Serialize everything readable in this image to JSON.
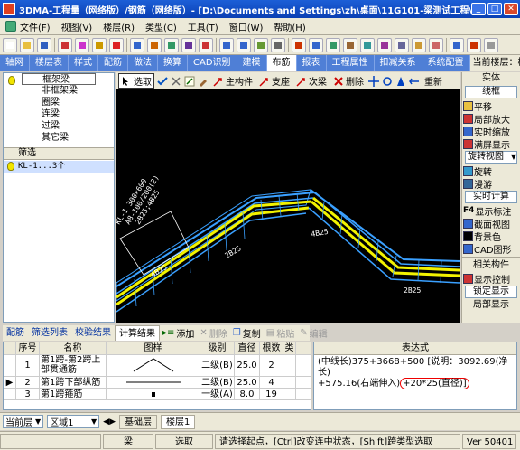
{
  "window": {
    "title": "3DMA-工程量（网络版）/钢筋（网络版）- [D:\\Documents and Settings\\zh\\桌面\\11G101-梁测试工程\\19...",
    "controls": [
      "_",
      "□",
      "✕"
    ]
  },
  "menu": {
    "items": [
      "文件(F)",
      "视图(V)",
      "楼层(R)",
      "类型(C)",
      "工具(T)",
      "窗口(W)",
      "帮助(H)"
    ]
  },
  "tabs": {
    "items": [
      "轴网",
      "楼层表",
      "样式",
      "配筋",
      "做法",
      "换算",
      "CAD识别",
      "建模",
      "布筋",
      "报表",
      "工程属性",
      "扣减关系",
      "系统配置"
    ],
    "active": "布筋",
    "current_floor": "当前楼层：楼"
  },
  "tree": {
    "items": [
      {
        "label": "框架梁",
        "selected": true
      },
      {
        "label": "非框架梁",
        "selected": false
      },
      {
        "label": "圈梁",
        "selected": false
      },
      {
        "label": "连梁",
        "selected": false
      },
      {
        "label": "过梁",
        "selected": false
      },
      {
        "label": "其它梁",
        "selected": false
      }
    ],
    "filter_header": "筛选",
    "filter_row": "KL-1...3个"
  },
  "view_toolbar": {
    "items": [
      "选取",
      "主构件",
      "支座",
      "次梁",
      "删除",
      "重新"
    ]
  },
  "canvas": {
    "labels": [
      "KL-1 300×600",
      "A8-100/200(2)",
      "2B25;4B25",
      "4B25",
      "2B25",
      "2B25",
      "4B25"
    ]
  },
  "right_panel": {
    "header": "实体",
    "box1": "线框",
    "items": [
      "平移",
      "局部放大",
      "实时缩放",
      "满屏显示"
    ],
    "combo": "旋转视图",
    "items2": [
      "旋转",
      "漫游"
    ],
    "box2": "实时计算",
    "items3": [
      "显示标注",
      "截面视图",
      "背景色",
      "CAD图形"
    ],
    "section": "相关构件",
    "item4": "显示控制",
    "box3": "锁定显示",
    "item5": "局部显示"
  },
  "bottom_tabs": {
    "items": [
      "配筋",
      "筛选列表",
      "校验结果",
      "计算结果"
    ],
    "active": "计算结果",
    "tools": [
      {
        "label": "添加",
        "enabled": true
      },
      {
        "label": "删除",
        "enabled": false
      },
      {
        "label": "复制",
        "enabled": true
      },
      {
        "label": "粘贴",
        "enabled": false
      },
      {
        "label": "编辑",
        "enabled": false
      }
    ]
  },
  "table": {
    "headers": [
      "序号",
      "名称",
      "图样",
      "级别",
      "直径",
      "根数",
      "类"
    ],
    "rows": [
      {
        "no": "1",
        "name": "第1跨-第2跨上部贯通筋",
        "grade": "二级(B)",
        "dia": "25.0",
        "count": "2"
      },
      {
        "no": "2",
        "name": "第1跨下部纵筋",
        "grade": "二级(B)",
        "dia": "25.0",
        "count": "4"
      },
      {
        "no": "3",
        "name": "第1跨箍筋",
        "grade": "一级(A)",
        "dia": "8.0",
        "count": "19"
      }
    ]
  },
  "expression": {
    "header": "表达式",
    "line1": "(中线长)375+3668+500 [说明：3092.69(净长)",
    "line2": "+575.16(右端伸入)",
    "highlight": "+20*25(直径)]"
  },
  "floorbar": {
    "current_floor_label": "当前层",
    "area_label": "区域1",
    "floor_tabs": [
      "基础层",
      "楼层1"
    ],
    "active_floor_tab": "楼层1"
  },
  "status": {
    "type": "梁",
    "mode": "选取",
    "hint": "请选择起点，[Ctrl]改变连中状态，[Shift]跨类型选取",
    "version": "Ver 50401"
  },
  "colors": {
    "title_bar": "#0a3fb3",
    "tab_bar": "#4f7fd6",
    "canvas_bg": "#000000",
    "rebar_blue": "#3aa0ff",
    "rebar_yellow": "#f2f200",
    "highlight_red": "#e00000"
  }
}
